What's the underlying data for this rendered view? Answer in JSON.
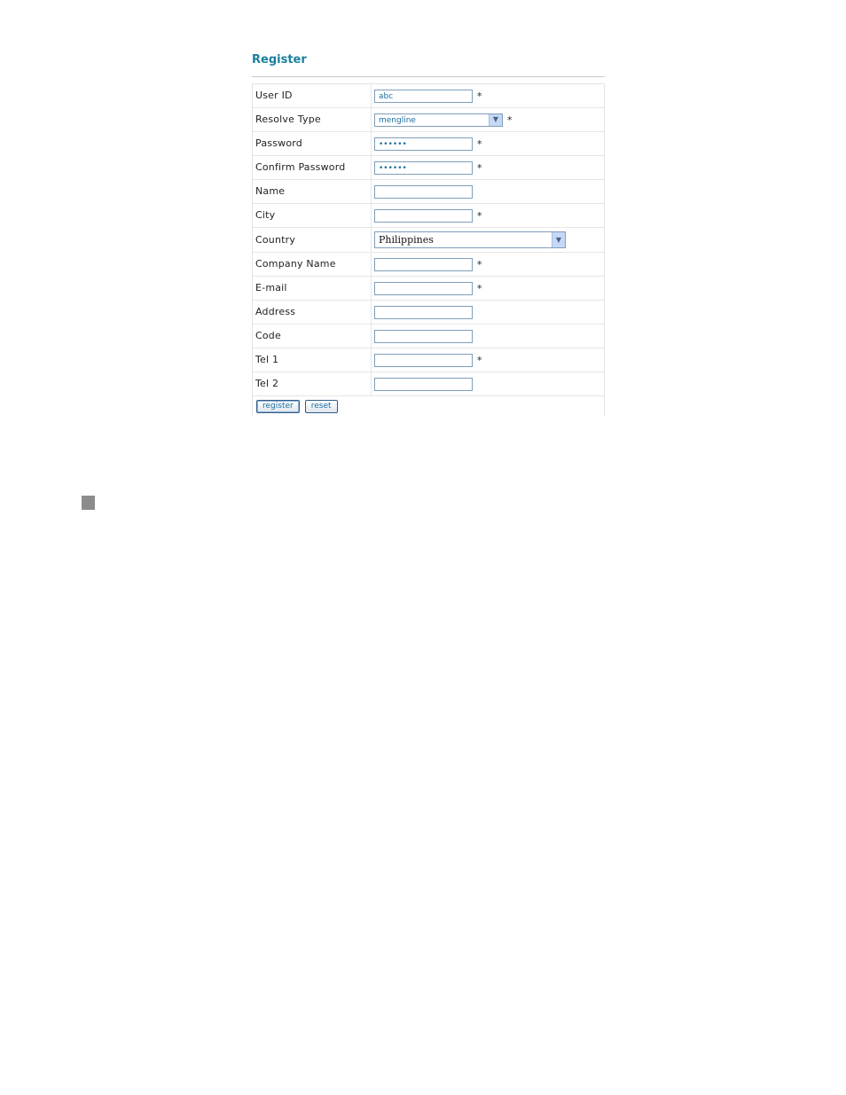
{
  "form": {
    "title": "Register",
    "required_mark": "*",
    "fields": {
      "user_id": {
        "label": "User ID",
        "value": "abc"
      },
      "resolve_type": {
        "label": "Resolve Type",
        "value": "mengline"
      },
      "password": {
        "label": "Password",
        "value": "••••••"
      },
      "confirm_password": {
        "label": "Confirm Password",
        "value": "••••••"
      },
      "name": {
        "label": "Name",
        "value": ""
      },
      "city": {
        "label": "City",
        "value": ""
      },
      "country": {
        "label": "Country",
        "value": "Philippines"
      },
      "company_name": {
        "label": "Company Name",
        "value": ""
      },
      "email": {
        "label": "E-mail",
        "value": ""
      },
      "address": {
        "label": "Address",
        "value": ""
      },
      "code": {
        "label": "Code",
        "value": ""
      },
      "tel1": {
        "label": "Tel 1",
        "value": ""
      },
      "tel2": {
        "label": "Tel 2",
        "value": ""
      }
    },
    "buttons": {
      "register": "register",
      "reset": "reset"
    }
  },
  "icons": {
    "dropdown": "chevron-down-icon",
    "bullet": "square-bullet-icon"
  },
  "colors": {
    "title": "#1a7f9c",
    "input_border": "#7f9db9",
    "bullet": "#8c8c8c"
  }
}
